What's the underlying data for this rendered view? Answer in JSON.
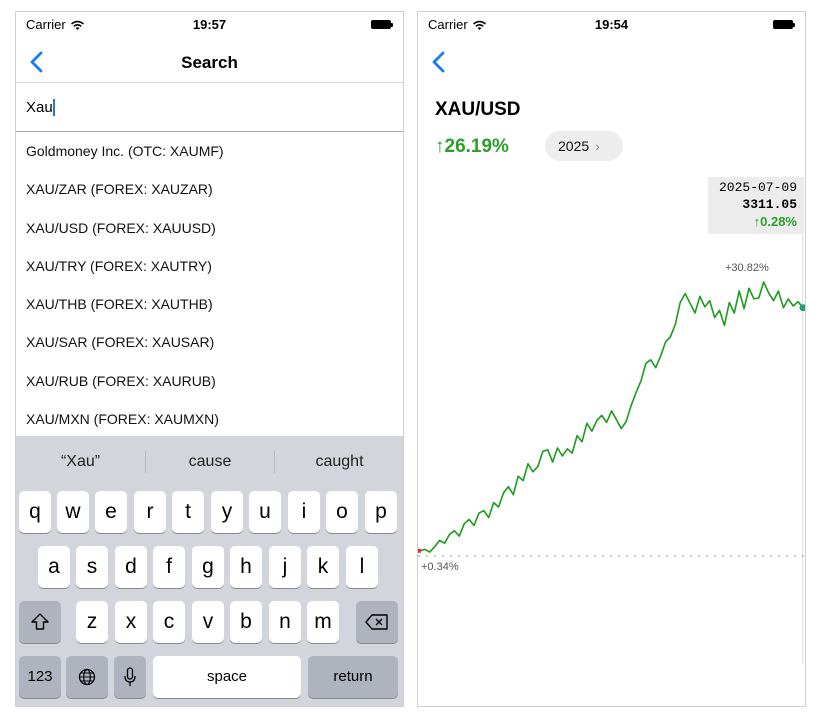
{
  "colors": {
    "accent": "#1a7cf2",
    "positive": "#2aa02a",
    "line": "#1c9b1c"
  },
  "left": {
    "status": {
      "carrier": "Carrier",
      "time": "19:57"
    },
    "nav": {
      "title": "Search",
      "back_icon": "chevron-left-icon"
    },
    "search": {
      "value": "Xau",
      "placeholder": ""
    },
    "results": [
      "Goldmoney Inc. (OTC: XAUMF)",
      "XAU/ZAR (FOREX: XAUZAR)",
      "XAU/USD (FOREX: XAUUSD)",
      "XAU/TRY (FOREX: XAUTRY)",
      "XAU/THB (FOREX: XAUTHB)",
      "XAU/SAR (FOREX: XAUSAR)",
      "XAU/RUB (FOREX: XAURUB)",
      "XAU/MXN (FOREX: XAUMXN)"
    ],
    "keyboard": {
      "suggestions": [
        "“Xau”",
        "cause",
        "caught"
      ],
      "row1": [
        "q",
        "w",
        "e",
        "r",
        "t",
        "y",
        "u",
        "i",
        "o",
        "p"
      ],
      "row2": [
        "a",
        "s",
        "d",
        "f",
        "g",
        "h",
        "j",
        "k",
        "l"
      ],
      "row3": [
        "z",
        "x",
        "c",
        "v",
        "b",
        "n",
        "m"
      ],
      "numbers_label": "123",
      "space_label": "space",
      "return_label": "return"
    }
  },
  "right": {
    "status": {
      "carrier": "Carrier",
      "time": "19:54"
    },
    "ticker": "XAU/USD",
    "change": "↑26.19%",
    "year_button": "2025",
    "tooltip": {
      "date": "2025-07-09",
      "value": "3311.05",
      "change": "↑0.28%"
    },
    "chart_data": {
      "type": "line",
      "title": "",
      "series": [
        {
          "values": [
            0.34,
            0.5,
            0.2,
            0.8,
            1.5,
            1.2,
            2.2,
            2.6,
            2.0,
            3.4,
            3.9,
            3.2,
            4.6,
            4.9,
            4.1,
            5.8,
            5.3,
            6.9,
            7.6,
            6.7,
            8.8,
            8.3,
            10.2,
            9.3,
            9.9,
            11.6,
            11.8,
            10.4,
            12.0,
            11.1,
            11.9,
            11.4,
            13.4,
            12.7,
            14.8,
            13.9,
            15.1,
            15.7,
            14.9,
            16.2,
            15.2,
            14.2,
            15.0,
            16.8,
            18.3,
            19.6,
            21.6,
            22.0,
            21.1,
            22.4,
            24.0,
            24.6,
            26.0,
            28.5,
            29.5,
            28.4,
            27.3,
            29.2,
            28.0,
            28.7,
            26.8,
            27.6,
            25.9,
            28.5,
            27.3,
            29.8,
            27.8,
            30.1,
            28.9,
            29.0,
            30.82,
            29.6,
            28.7,
            29.8,
            27.9,
            28.9,
            28.1,
            28.6,
            27.9
          ]
        }
      ],
      "annotations": [
        "+30.82%",
        "+0.34%"
      ]
    }
  }
}
